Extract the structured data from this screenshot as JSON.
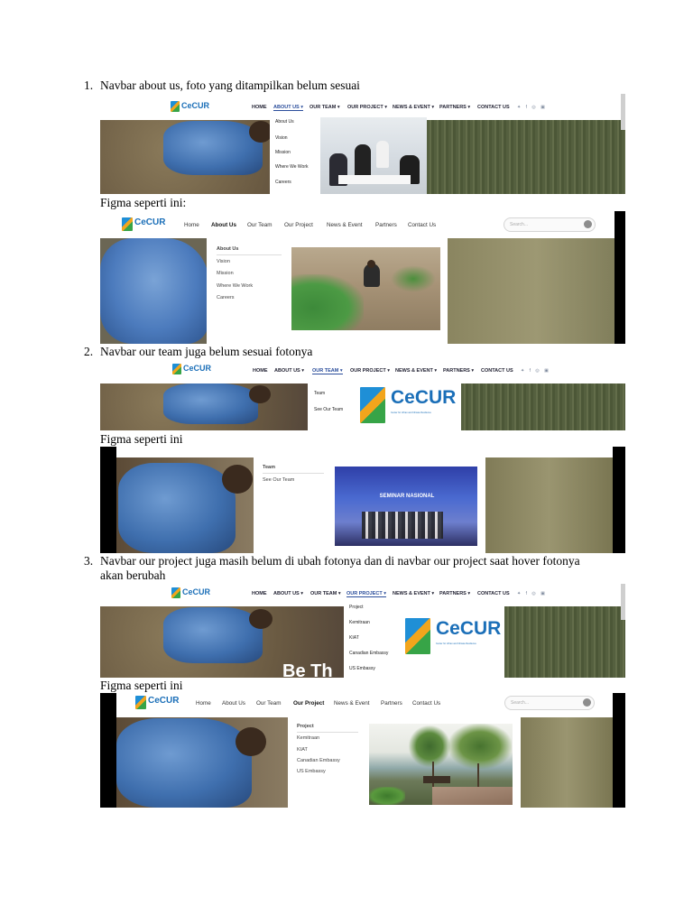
{
  "items": [
    {
      "number": "1.",
      "text": "Navbar about us, foto yang ditampilkan belum sesuai",
      "figma_caption": "Figma seperti ini:"
    },
    {
      "number": "2.",
      "text": "Navbar our team juga belum sesuai fotonya",
      "figma_caption": "Figma seperti ini"
    },
    {
      "number": "3.",
      "text_line1": "Navbar our project juga masih belum di ubah fotonya dan di navbar our project saat hover fotonya",
      "text_line2": "akan berubah",
      "figma_caption": "Figma seperti ini"
    }
  ],
  "logo": {
    "name": "CeCUR",
    "subtitle": "Center for Urban and Climate Resilience"
  },
  "site_nav": {
    "items": [
      "HOME",
      "ABOUT US ▾",
      "OUR TEAM ▾",
      "OUR PROJECT ▾",
      "NEWS & EVENT ▾",
      "PARTNERS ▾",
      "CONTACT US"
    ],
    "social": "✦ f ◎ ▣"
  },
  "figma_nav": {
    "items": [
      "Home",
      "About Us",
      "Our Team",
      "Our Project",
      "News & Event",
      "Partners",
      "Contact Us"
    ],
    "search_placeholder": "Search..."
  },
  "dropdowns": {
    "about_site": [
      "About Us",
      "Vision",
      "Mission",
      "Where We Work",
      "Careers"
    ],
    "about_figma": [
      "About Us",
      "Vision",
      "Mission",
      "Where We Work",
      "Careers"
    ],
    "team_site": [
      "Team",
      "See Our Team"
    ],
    "team_figma": [
      "Team",
      "See Our Team"
    ],
    "project_site": [
      "Project",
      "Kemitraan",
      "KIAT",
      "Canadian Embassy",
      "US Embassy"
    ],
    "project_figma": [
      "Project",
      "Kemitraan",
      "KIAT",
      "Canadian Embassy",
      "US Embassy"
    ]
  },
  "hero_text": "Be Th",
  "banner_text": "SEMINAR NASIONAL",
  "colors": {
    "brand_blue": "#1b6fb8",
    "nav_active": "#2a4d9b"
  }
}
